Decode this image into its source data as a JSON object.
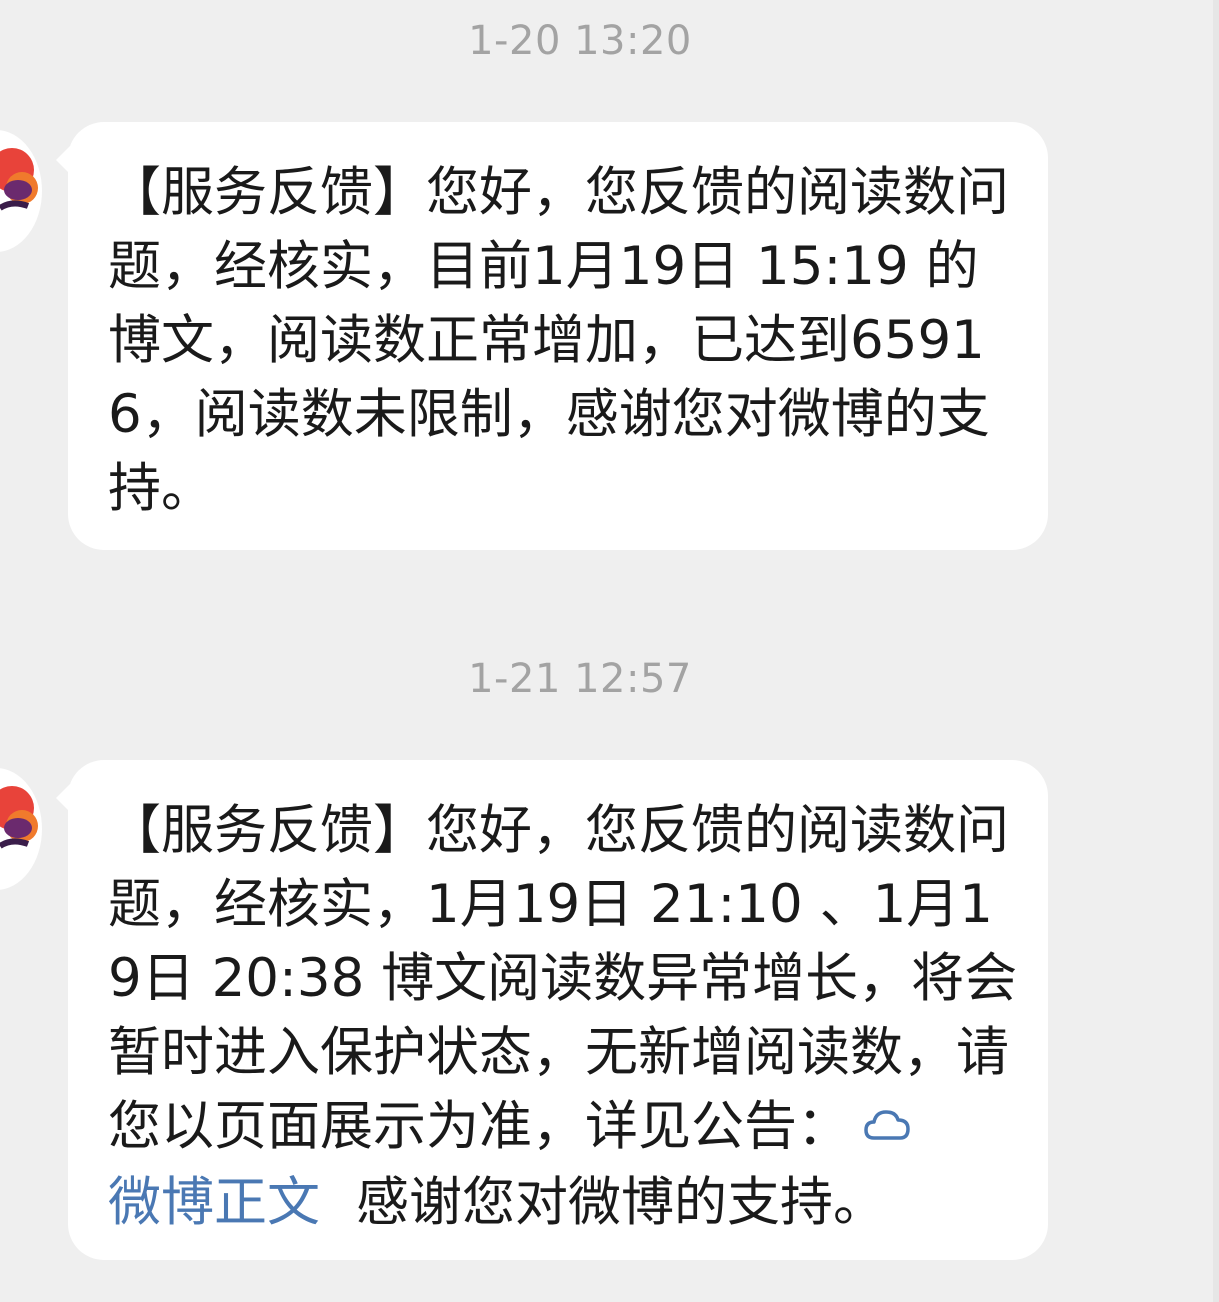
{
  "messages": [
    {
      "timestamp": "1-20 13:20",
      "text": "【服务反馈】您好，您反馈的阅读数问题，经核实，目前1月19日 15:19 的博文，阅读数正常增加，已达到65916，阅读数未限制，感谢您对微博的支持。"
    },
    {
      "timestamp": "1-21 12:57",
      "text": "【服务反馈】您好，您反馈的阅读数问题，经核实，1月19日 21:10 、1月19日 20:38 博文阅读数异常增长，将会暂时进入保护状态，无新增阅读数，请您以页面展示为准，详见公告：",
      "link_icon": "weibo-link-icon",
      "link_text": "微博正文",
      "text_after": "感谢您对微博的支持。"
    }
  ],
  "colors": {
    "background": "#efefef",
    "bubble": "#ffffff",
    "timestamp": "#a3a3a3",
    "link": "#4a78b3"
  }
}
